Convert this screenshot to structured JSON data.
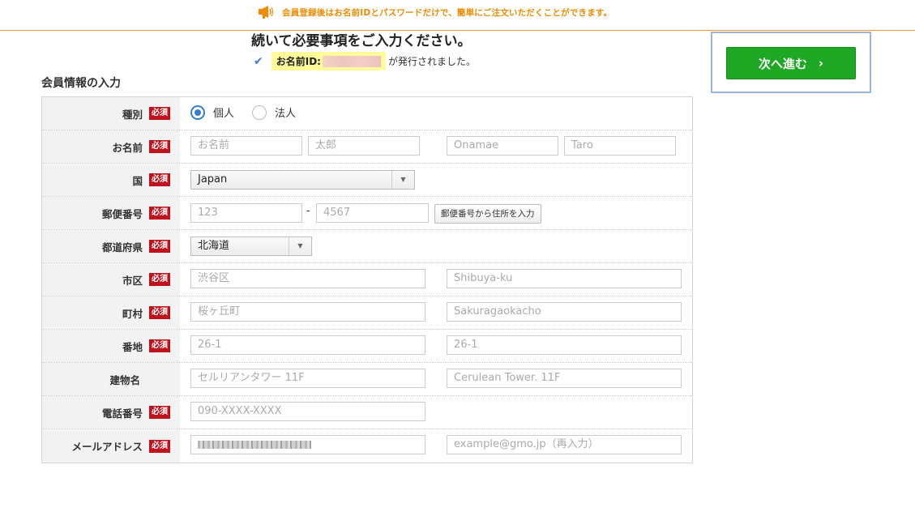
{
  "banner": {
    "icon": "megaphone-icon",
    "text": "会員登録後はお名前IDとパスワードだけで、簡単にご注文いただくことができます。"
  },
  "header": {
    "title": "続いて必要事項をご入力ください。",
    "id_label": "お名前ID:",
    "id_suffix": "が発行されました。"
  },
  "next_button": {
    "label": "次へ進む",
    "chevron": "›"
  },
  "section_title": "会員情報の入力",
  "required_label": "必須",
  "form": {
    "type": {
      "label": "種別",
      "options": [
        {
          "label": "個人",
          "checked": true
        },
        {
          "label": "法人",
          "checked": false
        }
      ]
    },
    "name": {
      "label": "お名前",
      "placeholders": [
        "お名前",
        "太郎",
        "Onamae",
        "Taro"
      ]
    },
    "country": {
      "label": "国",
      "value": "Japan"
    },
    "postal": {
      "label": "郵便番号",
      "placeholders": [
        "123",
        "4567"
      ],
      "dash": "-",
      "lookup_button": "郵便番号から住所を入力"
    },
    "prefecture": {
      "label": "都道府県",
      "value": "北海道"
    },
    "city": {
      "label": "市区",
      "placeholders": [
        "渋谷区",
        "Shibuya-ku"
      ]
    },
    "town": {
      "label": "町村",
      "placeholders": [
        "桜ヶ丘町",
        "Sakuragaokacho"
      ]
    },
    "address": {
      "label": "番地",
      "placeholders": [
        "26-1",
        "26-1"
      ]
    },
    "building": {
      "label": "建物名",
      "placeholders": [
        "セルリアンタワー 11F",
        "Cerulean Tower. 11F"
      ]
    },
    "phone": {
      "label": "電話番号",
      "placeholder": "090-XXXX-XXXX"
    },
    "email": {
      "label": "メールアドレス",
      "confirm_placeholder": "example@gmo.jp（再入力）"
    }
  }
}
